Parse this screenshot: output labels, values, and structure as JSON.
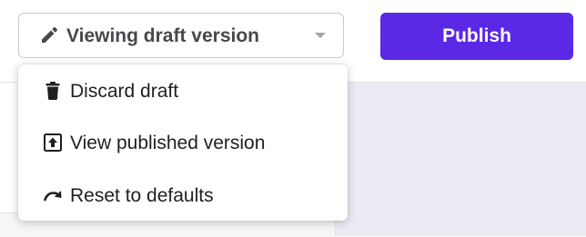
{
  "header": {
    "version_select": {
      "label": "Viewing draft version",
      "icon": "pencil-icon"
    },
    "publish_button": {
      "label": "Publish",
      "color": "#5b28e6"
    }
  },
  "dropdown": {
    "items": [
      {
        "label": "Discard draft",
        "icon": "trash-icon"
      },
      {
        "label": "View published version",
        "icon": "upload-box-icon"
      },
      {
        "label": "Reset to defaults",
        "icon": "redo-arrow-icon"
      }
    ]
  },
  "colors": {
    "accent": "#5b28e6",
    "text_primary": "#1f1f23",
    "text_secondary": "#48484d",
    "background_main": "#ebebf3"
  }
}
